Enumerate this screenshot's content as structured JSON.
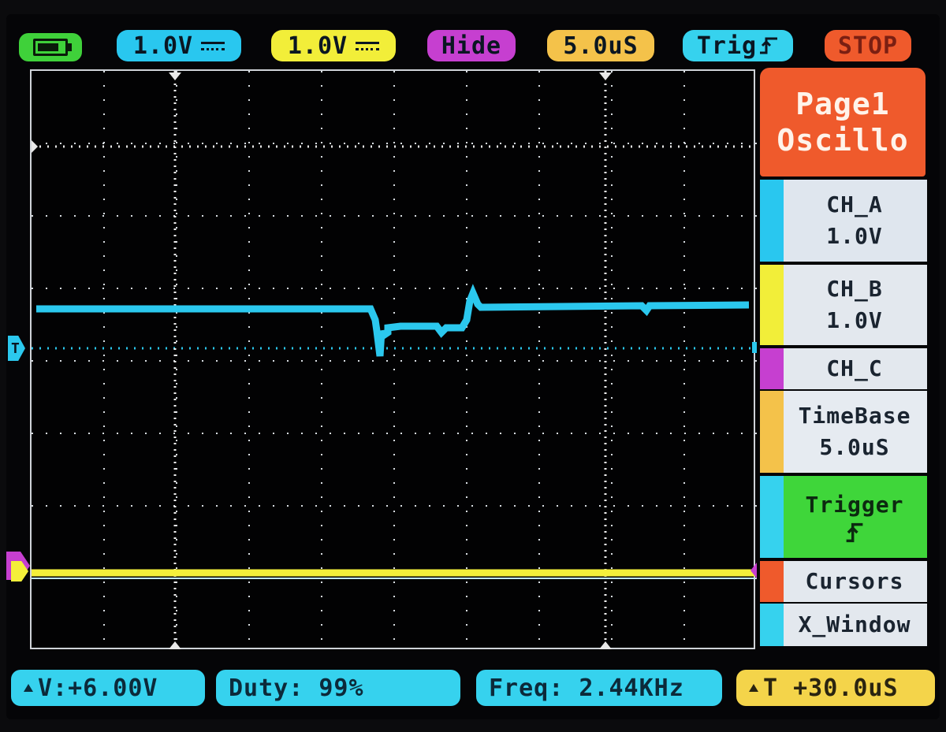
{
  "top_bar": {
    "battery_icon": "battery-icon",
    "channel_a": {
      "label": "1.0V",
      "color": "#29c7ef"
    },
    "channel_b": {
      "label": "1.0V",
      "color": "#f2ee39"
    },
    "channel_c": {
      "label": "Hide",
      "color": "#c63fd0"
    },
    "timebase": {
      "label": "5.0uS",
      "color": "#f4c24a"
    },
    "trigger": {
      "label": "Trig",
      "icon": "rising-edge-icon",
      "color": "#36d2ee"
    },
    "run_state": {
      "label": "STOP",
      "color": "#ef5a2c"
    }
  },
  "menu": {
    "page_title_line1": "Page1",
    "page_title_line2": "Oscillo",
    "items": [
      {
        "id": "ch_a",
        "line1": "CH_A",
        "line2": "1.0V",
        "tab_color": "#29c7ef"
      },
      {
        "id": "ch_b",
        "line1": "CH_B",
        "line2": "1.0V",
        "tab_color": "#f2ee39"
      },
      {
        "id": "ch_c",
        "line1": "CH_C",
        "tab_color": "#c63fd0"
      },
      {
        "id": "timebase",
        "line1": "TimeBase",
        "line2": "5.0uS",
        "tab_color": "#f4c24a"
      },
      {
        "id": "trigger",
        "line1": "Trigger",
        "line2": "⌒",
        "tab_color": "#36d2ee"
      },
      {
        "id": "cursors",
        "line1": "Cursors",
        "tab_color": "#ef5a2c"
      },
      {
        "id": "x_window",
        "line1": "X_Window",
        "tab_color": "#36d2ee"
      }
    ]
  },
  "bottom_bar": {
    "delta_v": "V:+6.00V",
    "duty": "Duty: 99%",
    "freq": "Freq: 2.44KHz",
    "delta_t": "T +30.0uS"
  },
  "plot": {
    "trigger_marker": "T",
    "grid_color": "#d8dde2",
    "channel_a_color": "#2bc8ee",
    "channel_b_color": "#f4f03a",
    "channel_c_color": "#c63fd0"
  }
}
